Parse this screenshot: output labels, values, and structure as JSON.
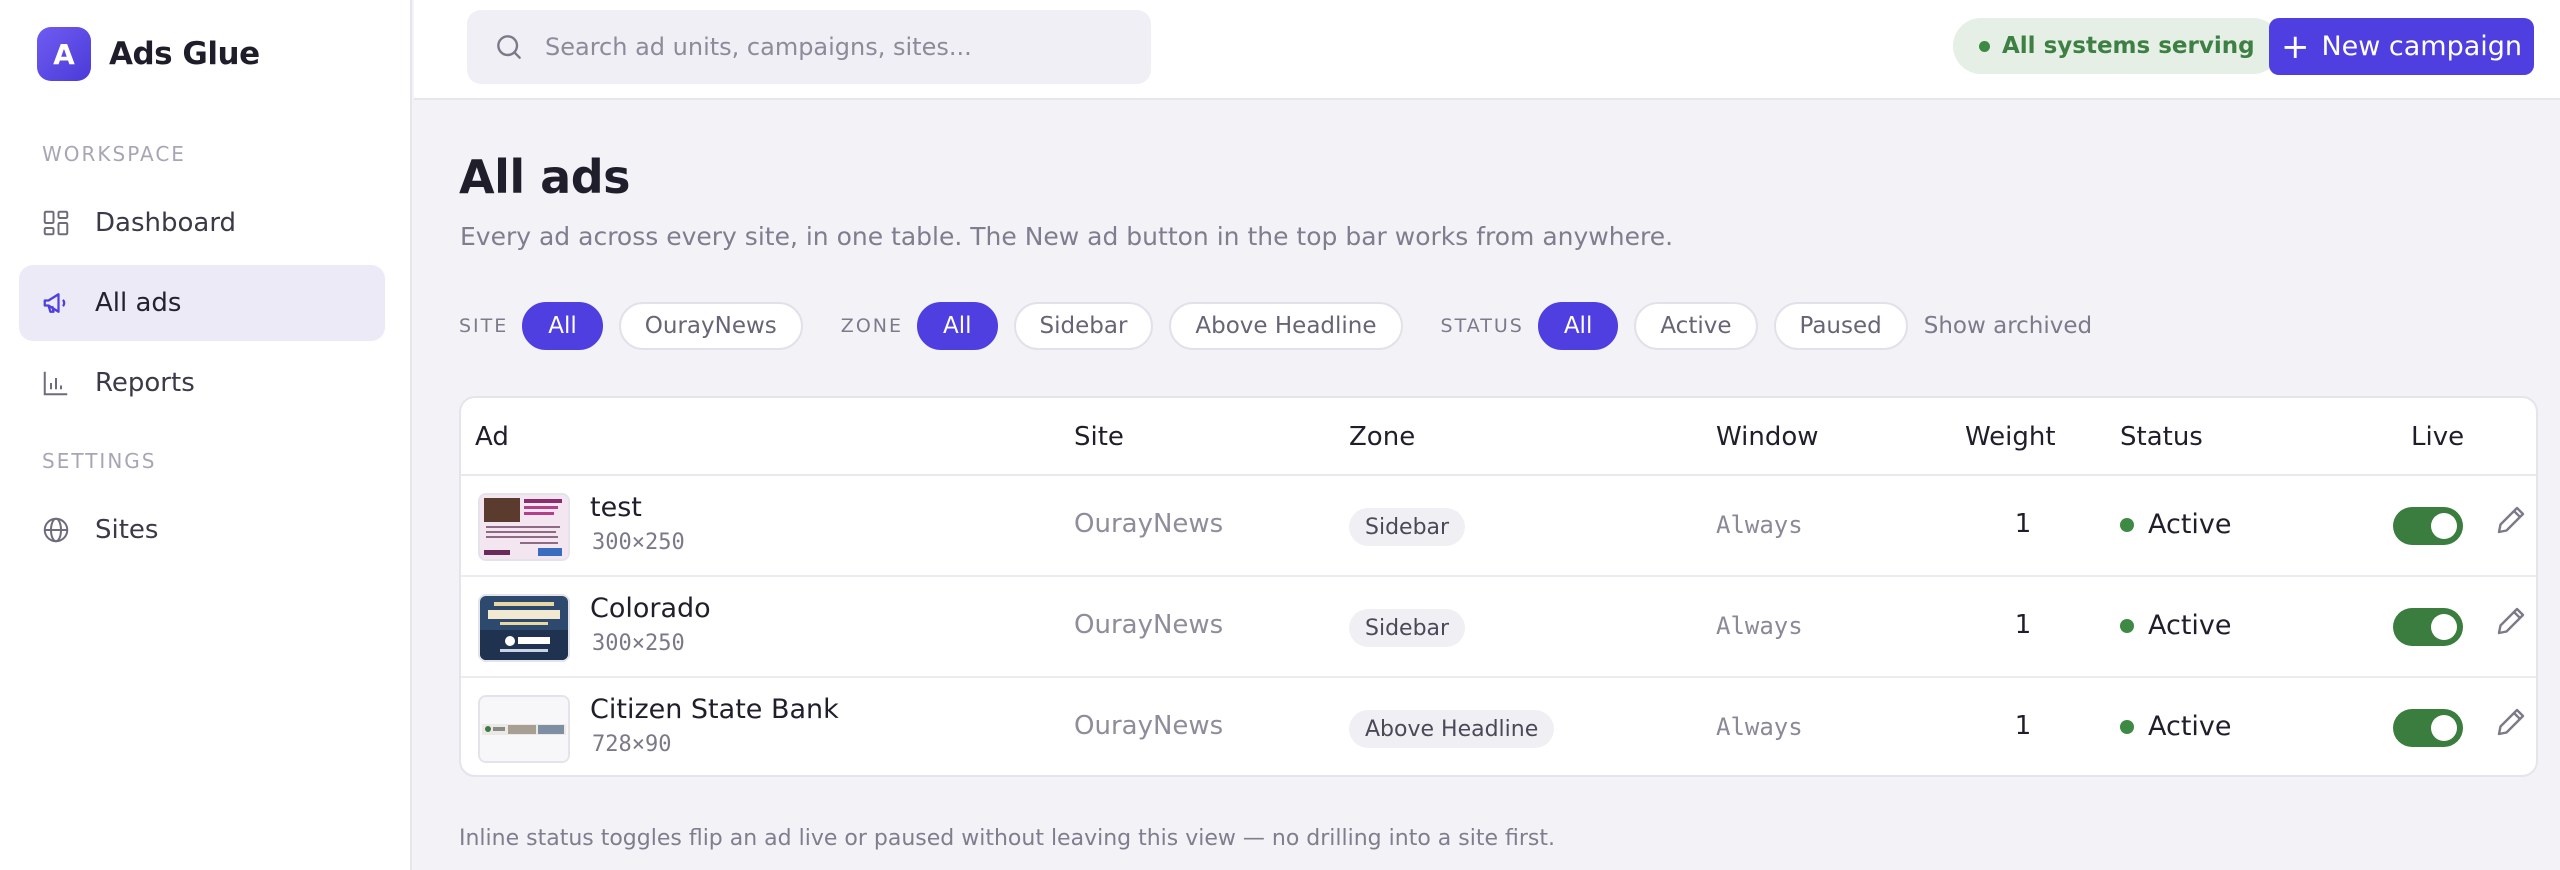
{
  "brand": {
    "mark": "A",
    "name": "Ads Glue"
  },
  "sidebar": {
    "workspace_label": "WORKSPACE",
    "settings_label": "SETTINGS",
    "items": [
      {
        "label": "Dashboard",
        "icon": "dashboard-icon",
        "active": false
      },
      {
        "label": "All ads",
        "icon": "megaphone-icon",
        "active": true
      },
      {
        "label": "Reports",
        "icon": "bar-chart-icon",
        "active": false
      },
      {
        "label": "Sites",
        "icon": "globe-icon",
        "active": false
      }
    ]
  },
  "topbar": {
    "search_placeholder": "Search ad units, campaigns, sites...",
    "status_text": "All systems serving",
    "new_button": "New campaign",
    "new_button_icon": "plus-icon"
  },
  "page": {
    "title": "All ads",
    "subtitle": "Every ad across every site, in one table. The New ad button in the top bar works from anywhere.",
    "footnote": "Inline status toggles flip an ad live or paused without leaving this view — no drilling into a site first."
  },
  "filters": {
    "site": {
      "label": "SITE",
      "options": [
        "All",
        "OurayNews"
      ],
      "selected": "All"
    },
    "zone": {
      "label": "ZONE",
      "options": [
        "All",
        "Sidebar",
        "Above Headline"
      ],
      "selected": "All"
    },
    "status": {
      "label": "STATUS",
      "options": [
        "All",
        "Active",
        "Paused"
      ],
      "selected": "All"
    },
    "show_archived": "Show archived"
  },
  "table": {
    "headers": {
      "ad": "Ad",
      "site": "Site",
      "zone": "Zone",
      "window": "Window",
      "weight": "Weight",
      "status": "Status",
      "live": "Live"
    },
    "rows": [
      {
        "name": "test",
        "size": "300×250",
        "site": "OurayNews",
        "zone": "Sidebar",
        "window": "Always",
        "weight": "1",
        "status": "Active",
        "live": true
      },
      {
        "name": "Colorado",
        "size": "300×250",
        "site": "OurayNews",
        "zone": "Sidebar",
        "window": "Always",
        "weight": "1",
        "status": "Active",
        "live": true
      },
      {
        "name": "Citizen State Bank",
        "size": "728×90",
        "site": "OurayNews",
        "zone": "Above Headline",
        "window": "Always",
        "weight": "1",
        "status": "Active",
        "live": true
      }
    ]
  },
  "colors": {
    "accent": "#4f3ee0",
    "active_green": "#3e8a45",
    "toggle_on": "#3a7d3f"
  }
}
